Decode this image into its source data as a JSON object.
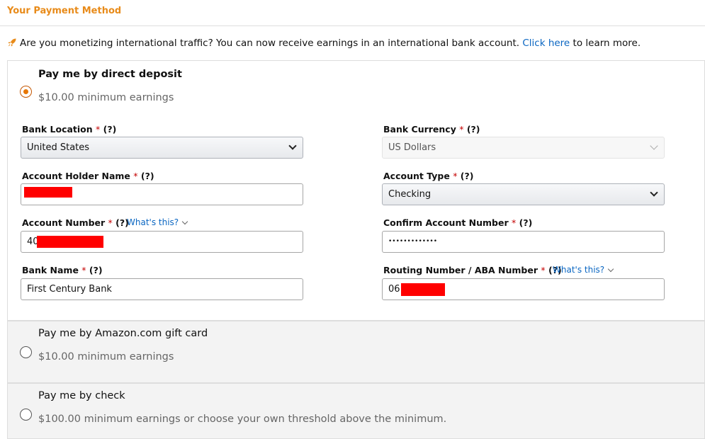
{
  "section_title": "Your Payment Method",
  "notice": {
    "text_before": "Are you monetizing international traffic? You can now receive earnings in an international bank account. ",
    "link": "Click here",
    "text_after": " to learn more."
  },
  "options": [
    {
      "title": "Pay me by direct deposit",
      "subtitle": "$10.00 minimum earnings",
      "selected": true
    },
    {
      "title": "Pay me by Amazon.com gift card",
      "subtitle": "$10.00 minimum earnings",
      "selected": false
    },
    {
      "title": "Pay me by check",
      "subtitle": "$100.00 minimum earnings or choose your own threshold above the minimum.",
      "selected": false
    }
  ],
  "form": {
    "bank_location": {
      "label": "Bank Location",
      "req": "*",
      "help": "(?)",
      "value": "United States"
    },
    "bank_currency": {
      "label": "Bank Currency",
      "req": "*",
      "help": "(?)",
      "value": "US Dollars"
    },
    "account_holder": {
      "label": "Account Holder Name",
      "req": "*",
      "help": "(?)",
      "value": ""
    },
    "account_type": {
      "label": "Account Type",
      "req": "*",
      "help": "(?)",
      "value": "Checking"
    },
    "account_number": {
      "label": "Account Number",
      "req": "*",
      "help": "(?)",
      "whats_this": "What's this?",
      "value": "40"
    },
    "confirm_account": {
      "label": "Confirm Account Number",
      "req": "*",
      "help": "(?)",
      "value": "•••••••••••••"
    },
    "bank_name": {
      "label": "Bank Name",
      "req": "*",
      "help": "(?)",
      "value": "First Century Bank"
    },
    "routing_number": {
      "label": "Routing Number / ABA Number",
      "req": "*",
      "help": "(?)",
      "whats_this": "What's this?",
      "value": "06"
    }
  },
  "colors": {
    "accent": "#e88b1a",
    "link": "#0a66c2",
    "required": "#c40000",
    "redaction": "#ff0000"
  }
}
